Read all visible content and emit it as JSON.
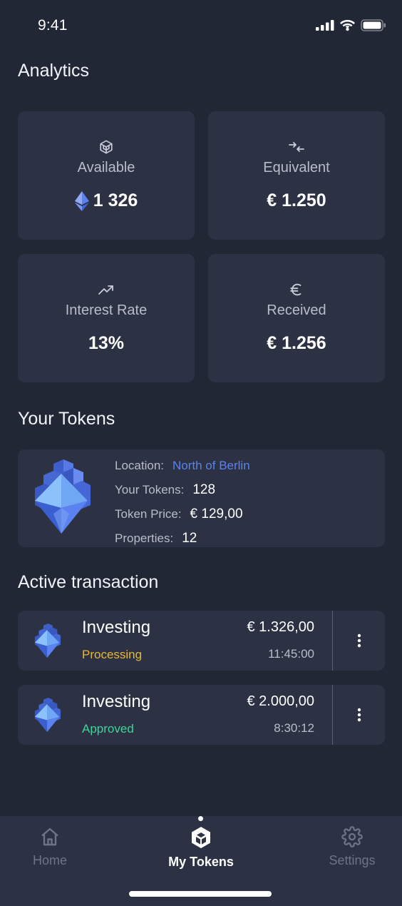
{
  "status_bar": {
    "time": "9:41"
  },
  "analytics": {
    "title": "Analytics",
    "cards": [
      {
        "icon": "cube-icon",
        "label": "Available",
        "value": "1 326"
      },
      {
        "icon": "exchange-icon",
        "label": "Equivalent",
        "value": "€ 1.250"
      },
      {
        "icon": "trending-up-icon",
        "label": "Interest Rate",
        "value": "13%"
      },
      {
        "icon": "euro-icon",
        "label": "Received",
        "value": "€ 1.256"
      }
    ]
  },
  "tokens": {
    "title": "Your Tokens",
    "location_label": "Location:",
    "location_value": "North of Berlin",
    "your_tokens_label": "Your Tokens:",
    "your_tokens_value": "128",
    "price_label": "Token Price:",
    "price_value": "€ 129,00",
    "properties_label": "Properties:",
    "properties_value": "12"
  },
  "transactions": {
    "title": "Active transaction",
    "items": [
      {
        "title": "Investing",
        "status": "Processing",
        "status_color": "#e8b830",
        "amount": "€ 1.326,00",
        "time": "11:45:00"
      },
      {
        "title": "Investing",
        "status": "Approved",
        "status_color": "#3fd49a",
        "amount": "€ 2.000,00",
        "time": "8:30:12"
      }
    ]
  },
  "tab_bar": {
    "tabs": [
      {
        "icon": "home-icon",
        "label": "Home",
        "active": false
      },
      {
        "icon": "tokens-icon",
        "label": "My Tokens",
        "active": true
      },
      {
        "icon": "gear-icon",
        "label": "Settings",
        "active": false
      }
    ]
  },
  "colors": {
    "background": "#222736",
    "card": "#2c3244",
    "accent": "#5b82f0"
  }
}
